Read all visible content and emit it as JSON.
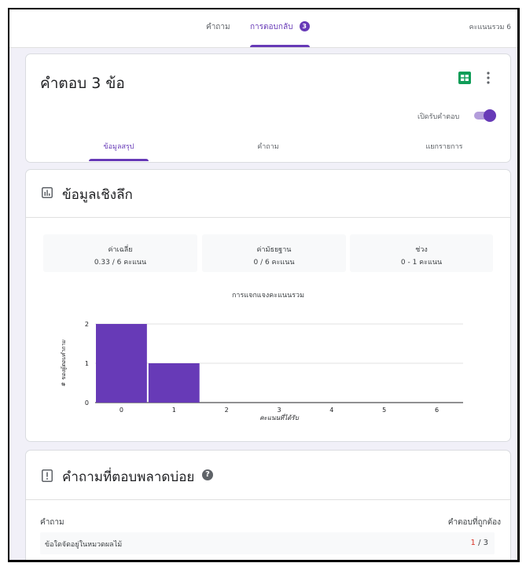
{
  "topbar": {
    "tab_questions": "คำถาม",
    "tab_responses": "การตอบกลับ",
    "responses_badge": "3",
    "total_points": "คะแนนรวม 6"
  },
  "responses_card": {
    "title": "คำตอบ 3 ข้อ",
    "accepting_label": "เปิดรับคำตอบ",
    "accepting": true,
    "subtabs": [
      "ข้อมูลสรุป",
      "คำถาม",
      "แยกรายการ"
    ],
    "active_subtab": "ข้อมูลสรุป"
  },
  "insights": {
    "title": "ข้อมูลเชิงลึก",
    "stats": [
      {
        "label": "ค่าเฉลี่ย",
        "value": "0.33 / 6 คะแนน"
      },
      {
        "label": "ค่ามัธยฐาน",
        "value": "0 / 6 คะแนน"
      },
      {
        "label": "ช่วง",
        "value": "0 - 1 คะแนน"
      }
    ],
    "chart_title": "การแจกแจงคะแนนรวม"
  },
  "chart_data": {
    "type": "bar",
    "title": "การแจกแจงคะแนนรวม",
    "categories": [
      "0",
      "1",
      "2",
      "3",
      "4",
      "5",
      "6"
    ],
    "values": [
      2,
      1,
      0,
      0,
      0,
      0,
      0
    ],
    "xlabel": "คะแนนที่ได้รับ",
    "ylabel": "# ของผู้ตอบคำถาม",
    "ylim": [
      0,
      2
    ],
    "yticks": [
      "0",
      "1",
      "2"
    ],
    "grid": true,
    "bar_color": "#673ab7"
  },
  "common_missed": {
    "title": "คำถามที่ตอบพลาดบ่อย",
    "help_icon": "?",
    "col_question": "คำถาม",
    "col_correct": "คำตอบที่ถูกต้อง",
    "rows": [
      {
        "question": "ข้อใดจัดอยู่ในหมวดผลไม้",
        "correct": "1",
        "total": " / 3"
      }
    ]
  },
  "colors": {
    "accent": "#673ab7",
    "sheets_green": "#0f9d58",
    "incorrect_red": "#d93025"
  }
}
